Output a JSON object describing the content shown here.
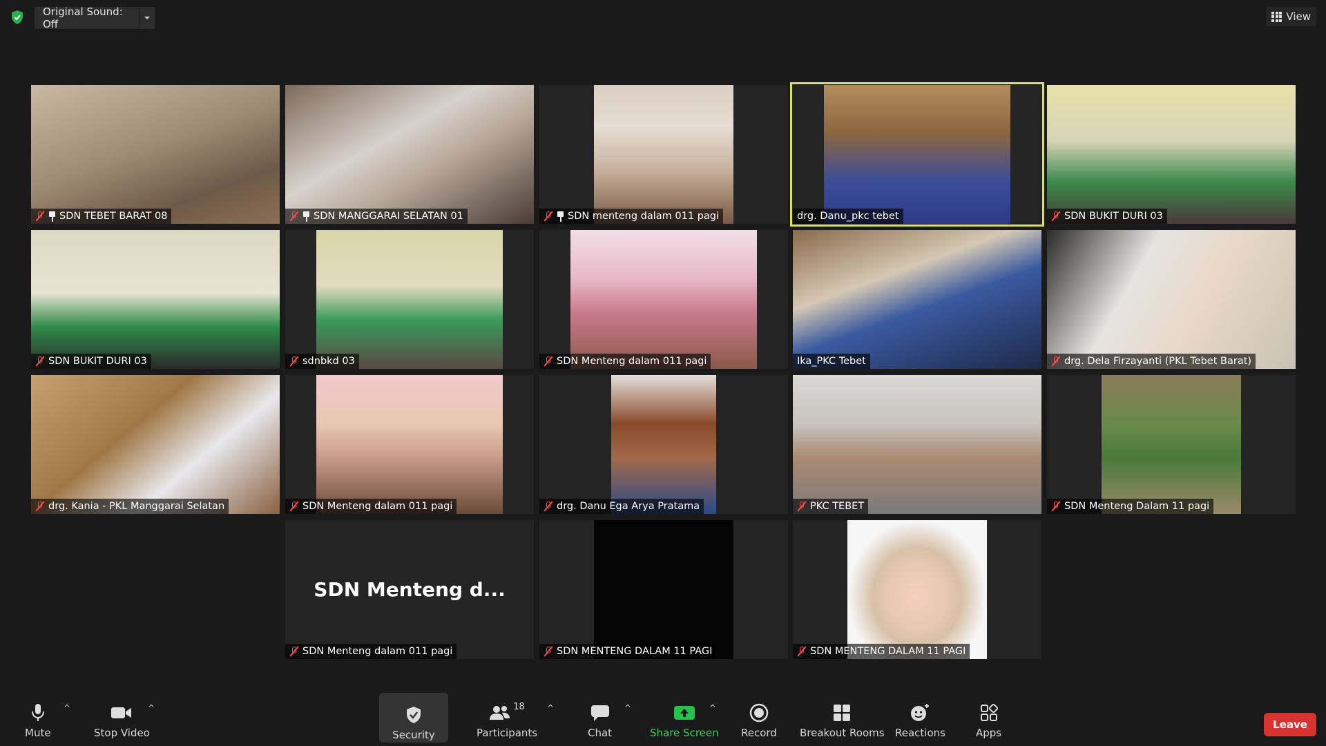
{
  "top_bar": {
    "original_sound_label": "Original Sound: Off",
    "view_label": "View"
  },
  "participants": [
    {
      "name": "SDN TEBET BARAT 08",
      "muted": true,
      "pinned": true
    },
    {
      "name": "SDN MANGGARAI SELATAN 01",
      "muted": true,
      "pinned": true
    },
    {
      "name": "SDN menteng dalam 011 pagi",
      "muted": true,
      "pinned": true
    },
    {
      "name": "drg. Danu_pkc tebet",
      "muted": false,
      "active_speaker": true
    },
    {
      "name": "SDN BUKIT DURI 03",
      "muted": true
    },
    {
      "name": "SDN BUKIT DURI 03",
      "muted": true
    },
    {
      "name": "sdnbkd 03",
      "muted": true
    },
    {
      "name": "SDN Menteng dalam 011 pagi",
      "muted": true
    },
    {
      "name": "Ika_PKC Tebet",
      "muted": false
    },
    {
      "name": "drg. Dela Firzayanti (PKL Tebet Barat)",
      "muted": true
    },
    {
      "name": "drg. Kania - PKL Manggarai Selatan",
      "muted": true
    },
    {
      "name": "SDN Menteng dalam 011 pagi",
      "muted": true
    },
    {
      "name": "drg. Danu Ega Arya Pratama",
      "muted": true
    },
    {
      "name": "PKC TEBET",
      "muted": true
    },
    {
      "name": "SDN Menteng Dalam 11 pagi",
      "muted": true
    },
    {
      "name": "SDN Menteng dalam 011 pagi",
      "muted": true,
      "video_off_name": "SDN Menteng d..."
    },
    {
      "name": "SDN MENTENG DALAM 11 PAGI",
      "muted": true
    },
    {
      "name": "SDN MENTENG DALAM 11 PAGI",
      "muted": true
    }
  ],
  "toolbar": {
    "mute": "Mute",
    "stop_video": "Stop Video",
    "security": "Security",
    "participants": "Participants",
    "participants_count": "18",
    "chat": "Chat",
    "share_screen": "Share Screen",
    "record": "Record",
    "breakout_rooms": "Breakout Rooms",
    "reactions": "Reactions",
    "apps": "Apps",
    "leave": "Leave"
  },
  "colors": {
    "background": "#1a1a1a",
    "active_speaker_border": "#dbe93a",
    "share_screen_green": "#24c24a",
    "leave_red": "#d9332f",
    "muted_red": "#ff4b4b"
  }
}
